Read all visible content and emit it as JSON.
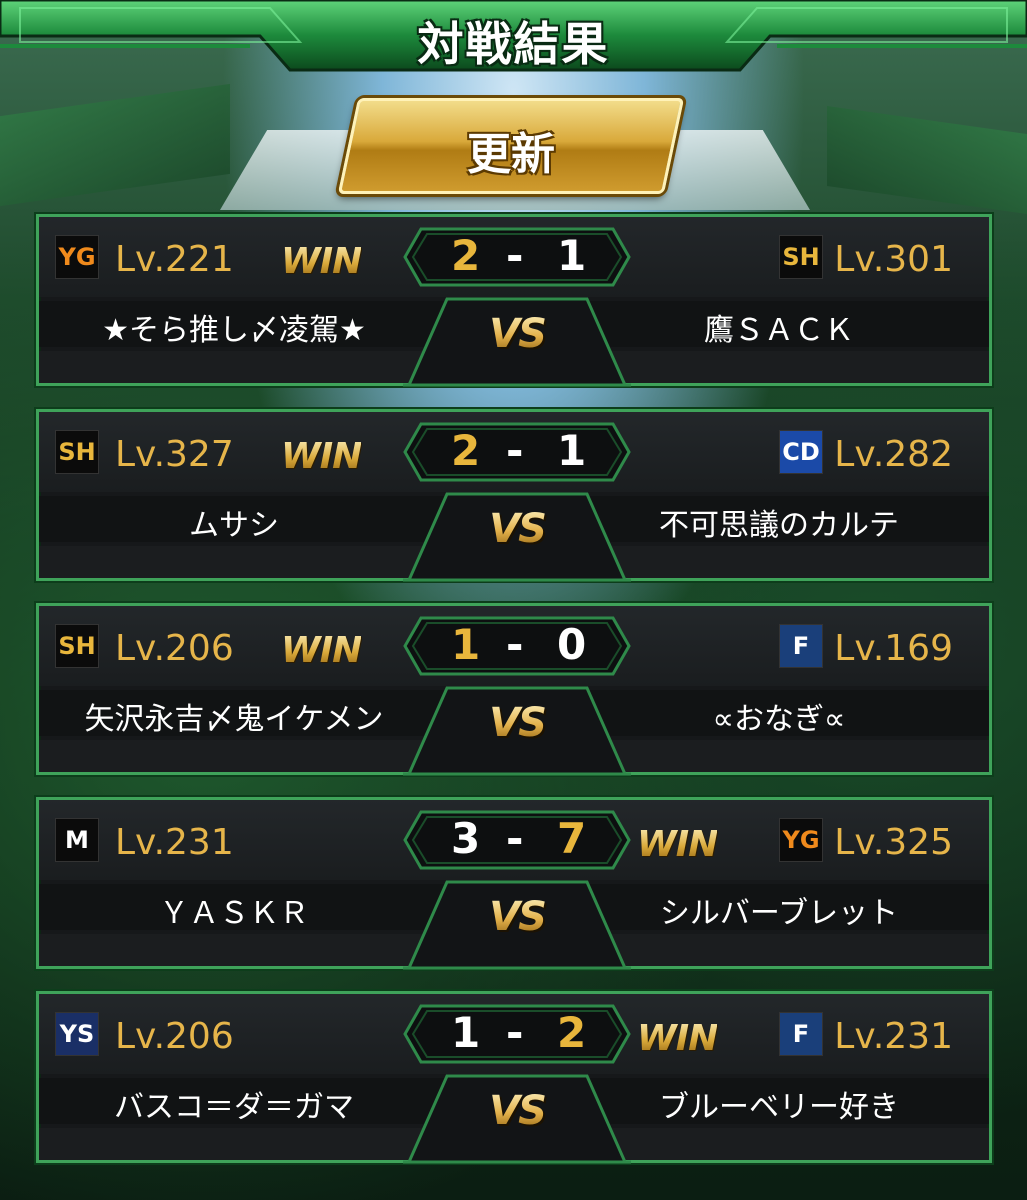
{
  "header": {
    "title": "対戦結果"
  },
  "refresh_button": {
    "label": "更新"
  },
  "vs_label": "VS",
  "win_label": "WIN",
  "score_separator": "-",
  "matches": [
    {
      "left": {
        "team_icon": "giants-logo-icon",
        "logo_text": "YG",
        "logo_color": "#f08a1c",
        "logo_bg": "#0b0b0b",
        "level": "Lv.221",
        "name": "★そら推し〆凌駕★",
        "score": "2",
        "winner": true
      },
      "right": {
        "team_icon": "hawks-logo-icon",
        "logo_text": "SH",
        "logo_color": "#e8b63c",
        "logo_bg": "#0b0b0b",
        "level": "Lv.301",
        "name": "鷹ＳＡＣＫ",
        "score": "1",
        "winner": false
      }
    },
    {
      "left": {
        "team_icon": "hawks-logo-icon",
        "logo_text": "SH",
        "logo_color": "#e8b63c",
        "logo_bg": "#0b0b0b",
        "level": "Lv.327",
        "name": "ムサシ",
        "score": "2",
        "winner": true
      },
      "right": {
        "team_icon": "dragons-logo-icon",
        "logo_text": "CD",
        "logo_color": "#ffffff",
        "logo_bg": "#1b4aa8",
        "level": "Lv.282",
        "name": "不可思議のカルテ",
        "score": "1",
        "winner": false
      }
    },
    {
      "left": {
        "team_icon": "hawks-logo-icon",
        "logo_text": "SH",
        "logo_color": "#e8b63c",
        "logo_bg": "#0b0b0b",
        "level": "Lv.206",
        "name": "矢沢永吉〆鬼イケメン",
        "score": "1",
        "winner": true
      },
      "right": {
        "team_icon": "fighters-logo-icon",
        "logo_text": "F",
        "logo_color": "#ffffff",
        "logo_bg": "#1a3f7a",
        "level": "Lv.169",
        "name": "∝おなぎ∝",
        "score": "0",
        "winner": false
      }
    },
    {
      "left": {
        "team_icon": "marines-logo-icon",
        "logo_text": "M",
        "logo_color": "#ffffff",
        "logo_bg": "#0b0b0b",
        "level": "Lv.231",
        "name": "ＹＡＳＫＲ",
        "score": "3",
        "winner": false
      },
      "right": {
        "team_icon": "giants-logo-icon",
        "logo_text": "YG",
        "logo_color": "#f08a1c",
        "logo_bg": "#0b0b0b",
        "level": "Lv.325",
        "name": "シルバーブレット",
        "score": "7",
        "winner": true
      }
    },
    {
      "left": {
        "team_icon": "swallows-logo-icon",
        "logo_text": "YS",
        "logo_color": "#ffffff",
        "logo_bg": "#1a2f66",
        "level": "Lv.206",
        "name": "バスコ＝ダ＝ガマ",
        "score": "1",
        "winner": false
      },
      "right": {
        "team_icon": "fighters-logo-icon",
        "logo_text": "F",
        "logo_color": "#ffffff",
        "logo_bg": "#1a3f7a",
        "level": "Lv.231",
        "name": "ブルーベリー好き",
        "score": "2",
        "winner": true
      }
    }
  ]
}
